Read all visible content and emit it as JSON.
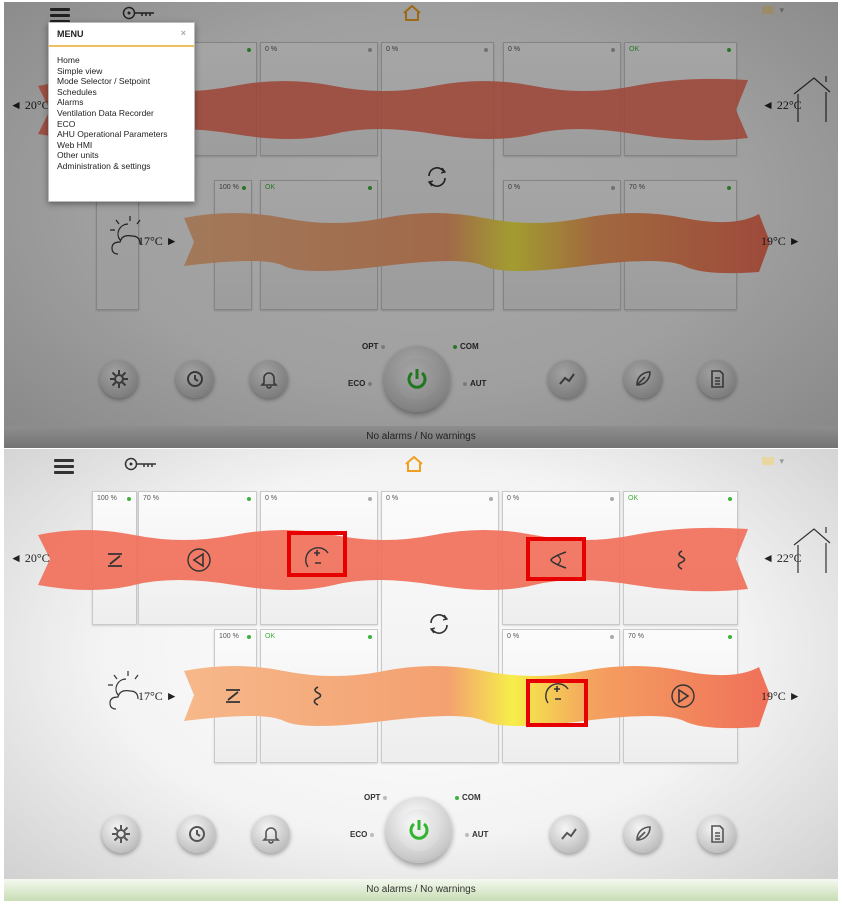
{
  "status": {
    "text": "No alarms / No warnings"
  },
  "menu": {
    "title": "MENU",
    "close": "×",
    "items": [
      {
        "label": "Home"
      },
      {
        "label": "Simple view"
      },
      {
        "label": "Mode Selector / Setpoint"
      },
      {
        "label": "Schedules"
      },
      {
        "label": "Alarms"
      },
      {
        "label": "Ventilation Data Recorder"
      },
      {
        "label": "ECO"
      },
      {
        "label": "AHU Operational Parameters"
      },
      {
        "label": "Web HMI"
      },
      {
        "label": "Other units"
      },
      {
        "label": "Administration & settings"
      }
    ]
  },
  "temperatures": {
    "extract_in": "◄ 20°C",
    "exhaust_room": "◄ 22°C",
    "outdoor": "17°C ►",
    "supply": "19°C ►"
  },
  "tiles": {
    "t_100_top": "100 %",
    "t_70_top": "70 %",
    "t_0_a": "0 %",
    "t_0_b": "0 %",
    "t_0_c": "0 %",
    "t_ok_top": "OK",
    "t_100_bot": "100 %",
    "t_ok_bot": "OK",
    "t_0_bot": "0 %",
    "t_70_bot": "70 %"
  },
  "modes": {
    "opt": "OPT",
    "com": "COM",
    "eco": "ECO",
    "aut": "AUT"
  },
  "colors": {
    "band_top": "#f0705a",
    "band_bottom_warm": "#f6b88a",
    "band_yellow": "#f6ee4a",
    "highlight": "#e60000",
    "status_dot": "#3cb43c"
  },
  "icons": {
    "menu": "hamburger-icon",
    "key": "key-icon",
    "home": "home-icon",
    "settings": "gear-icon",
    "history": "history-icon",
    "alarm": "bell-icon",
    "power": "power-icon",
    "trend": "trend-icon",
    "eco": "leaf-icon",
    "report": "document-icon"
  }
}
